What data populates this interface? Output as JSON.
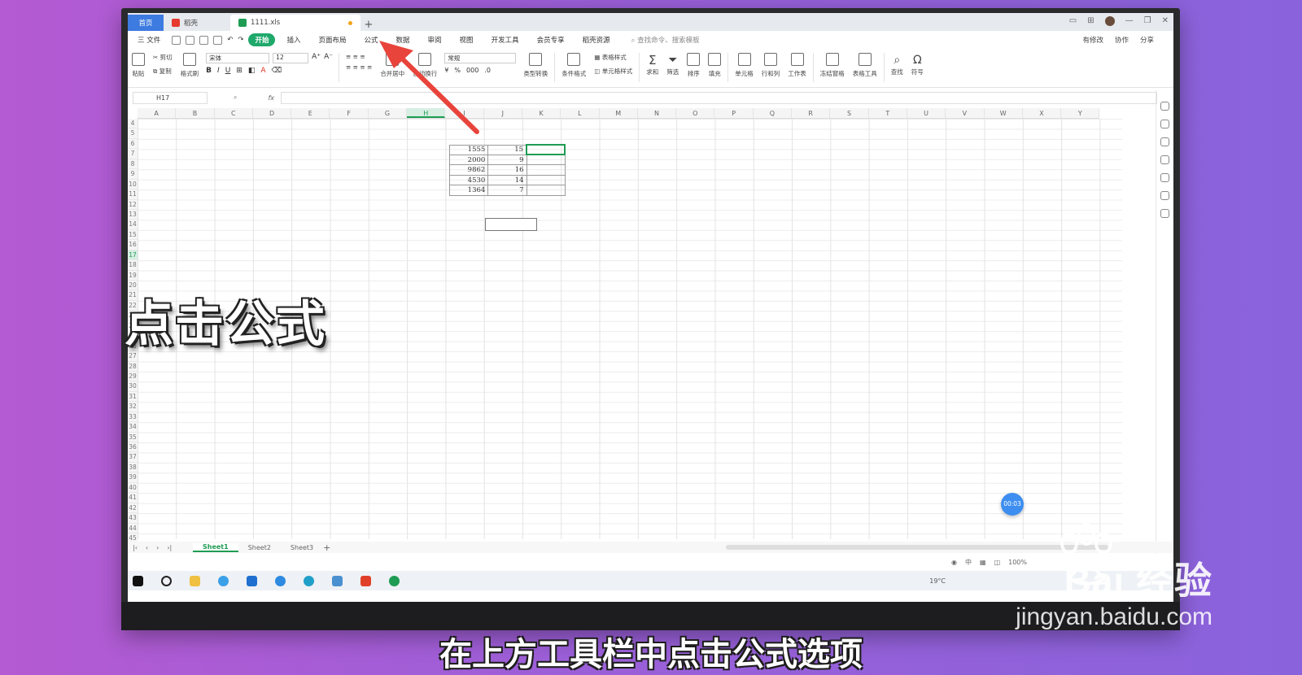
{
  "window": {
    "tabs": [
      {
        "label": "首页"
      },
      {
        "label": "稻壳"
      },
      {
        "label": "1111.xls"
      }
    ],
    "new_tab": "+"
  },
  "menu": {
    "file": "三 文件",
    "items": [
      "开始",
      "插入",
      "页面布局",
      "公式",
      "数据",
      "审阅",
      "视图",
      "开发工具",
      "会员专享",
      "稻壳资源"
    ],
    "active_index": 0,
    "search_placeholder": "查找命令、搜索模板",
    "right": [
      "有修改",
      "协作",
      "分享"
    ]
  },
  "ribbon": {
    "paste": "粘贴",
    "cut": "剪切",
    "copy": "复制",
    "format_painter": "格式刷",
    "font": "宋体",
    "font_size": "12",
    "merge": "合并居中",
    "wrap": "自动换行",
    "number_format": "常规",
    "convert": "类型转换",
    "cond_format": "条件格式",
    "table_style": "表格样式",
    "cell_style": "单元格样式",
    "sum": "求和",
    "filter": "筛选",
    "sort": "排序",
    "fill": "填充",
    "cell": "单元格",
    "rowcol": "行和列",
    "sheet": "工作表",
    "freeze": "冻结窗格",
    "tools": "表格工具",
    "find": "查找",
    "symbol": "符号"
  },
  "formula_bar": {
    "name_box": "H17",
    "fx": "fx"
  },
  "columns": [
    "A",
    "B",
    "C",
    "D",
    "E",
    "F",
    "G",
    "H",
    "I",
    "J",
    "K",
    "L",
    "M",
    "N",
    "O",
    "P",
    "Q",
    "R",
    "S",
    "T",
    "U",
    "V",
    "W",
    "X",
    "Y"
  ],
  "rows": [
    "4",
    "5",
    "6",
    "7",
    "8",
    "9",
    "10",
    "11",
    "12",
    "13",
    "14",
    "15",
    "16",
    "17",
    "18",
    "19",
    "20",
    "21",
    "22",
    "23",
    "24",
    "25",
    "26",
    "27",
    "28",
    "29",
    "30",
    "31",
    "32",
    "33",
    "34",
    "35",
    "36",
    "37",
    "38",
    "39",
    "40",
    "41",
    "42",
    "43",
    "44",
    "45"
  ],
  "cells": [
    {
      "f": "1555",
      "g": "15",
      "h": ""
    },
    {
      "f": "2000",
      "g": "9",
      "h": ""
    },
    {
      "f": "9862",
      "g": "16",
      "h": ""
    },
    {
      "f": "4530",
      "g": "14",
      "h": ""
    },
    {
      "f": "1364",
      "g": "7",
      "h": ""
    }
  ],
  "sheets": [
    "Sheet1",
    "Sheet2",
    "Sheet3"
  ],
  "status": {
    "zoom": "100%"
  },
  "taskbar": {
    "weather": "19°C"
  },
  "timer": "00:03",
  "overlay_title": "点击公式",
  "caption": "在上方工具栏中点击公式选项",
  "watermark": {
    "brand": "Bai 经验",
    "url": "jingyan.baidu.com"
  },
  "colors": {
    "accent": "#1ea86a",
    "arrow": "#e8443b",
    "timer": "#3d8ef0"
  }
}
